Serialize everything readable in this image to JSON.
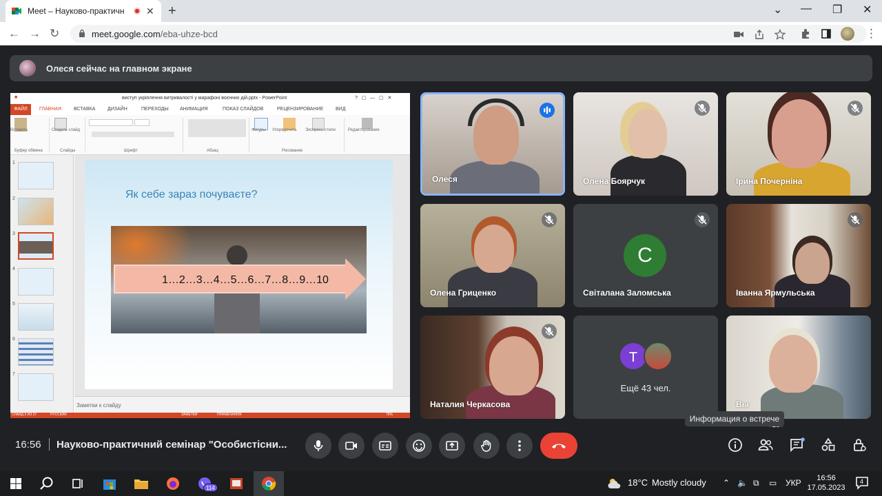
{
  "browser": {
    "tab_title": "Meet – Науково-практичн",
    "new_tab": "+",
    "url_host": "meet.google.com",
    "url_path": "/eba-uhze-bcd",
    "minimize": "⌄",
    "min": "—",
    "restore": "❐",
    "close": "✕",
    "tab_close": "✕"
  },
  "banner": {
    "text": "Олеся сейчас на главном экране"
  },
  "presentation": {
    "window_title": "виступ укріплення витривалості у марафоні воєнних дій.pptx - PowerPoint",
    "menu": [
      "ФАЙЛ",
      "ГЛАВНАЯ",
      "ВСТАВКА",
      "ДИЗАЙН",
      "ПЕРЕХОДЫ",
      "АНИМАЦИЯ",
      "ПОКАЗ СЛАЙДОВ",
      "РЕЦЕНЗИРОВАНИЕ",
      "ВИД"
    ],
    "ribbon_groups": [
      "Буфер обмена",
      "Слайды",
      "Шрифт",
      "Абзац",
      "Рисование",
      "Редактирование"
    ],
    "ribbon_buttons": [
      "Вставить",
      "Создать слайд",
      "Фигуры",
      "Упорядочить",
      "Экспресс-стили",
      "Редактирование"
    ],
    "slide_numbers": [
      "1",
      "2",
      "3",
      "4",
      "5",
      "6",
      "7"
    ],
    "slide_heading": "Як себе зараз почуваєте?",
    "scale_text": "1…2…3…4…5…6…7…8…9…10",
    "notes_placeholder": "Заметки к слайду",
    "status_left": "СЛАЙД 3 ИЗ 27",
    "status_lang": "РУССКИЙ",
    "status_notes": "ЗАМЕТКИ",
    "status_comments": "ПРИМЕЧАНИЯ",
    "zoom": "76%"
  },
  "participants": [
    {
      "name": "Олеся",
      "speaking": true
    },
    {
      "name": "Олена Боярчук",
      "muted": true
    },
    {
      "name": "Ірина Почерніна",
      "muted": true
    },
    {
      "name": "Олена Гриценко",
      "muted": true
    },
    {
      "name": "Світалана Заломська",
      "muted": true,
      "initial": "С"
    },
    {
      "name": "Іванна Ярмульська",
      "muted": true
    },
    {
      "name": "Наталия Черкасова",
      "muted": true
    },
    {
      "name": "Ещё 43 чел.",
      "initial": "Т"
    },
    {
      "name": "Вы"
    }
  ],
  "tooltip": "Информация о встрече",
  "bottom_bar": {
    "time": "16:56",
    "meeting_title": "Науково-практичний семінар \"Особистісни...",
    "people_count": "50"
  },
  "taskbar": {
    "temperature": "18°C",
    "weather": "Mostly cloudy",
    "viber_badge": "114",
    "lang": "УКР",
    "clock_time": "16:56",
    "clock_date": "17.05.2023",
    "notifications": "4"
  },
  "colors": {
    "meet_bg": "#202124",
    "tile_bg": "#3c4043",
    "hangup": "#ea4335",
    "active_speaker": "#8ab4f8",
    "powerpoint": "#d24726"
  }
}
